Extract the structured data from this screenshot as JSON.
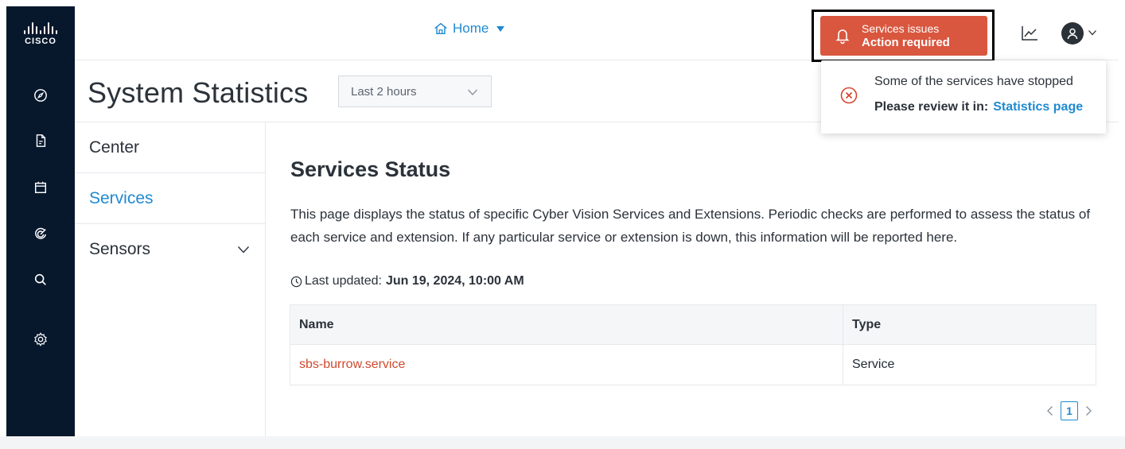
{
  "brand": {
    "logo_text": "CISCO"
  },
  "header": {
    "home_label": "Home",
    "alert": {
      "line1": "Services issues",
      "line2": "Action required"
    }
  },
  "page": {
    "title": "System Statistics",
    "time_range": {
      "selected": "Last 2 hours"
    }
  },
  "popover": {
    "message": "Some of the services have stopped",
    "review_label": "Please review it in:",
    "link_label": "Statistics page"
  },
  "sidebar": {
    "items": [
      {
        "label": "Center"
      },
      {
        "label": "Services"
      },
      {
        "label": "Sensors"
      }
    ],
    "active": "Services"
  },
  "main": {
    "section_title": "Services Status",
    "description": "This page displays the status of specific Cyber Vision Services and Extensions. Periodic checks are performed to assess the status of each service and extension. If any particular service or extension is down, this information will be reported here.",
    "last_updated_label": "Last updated:",
    "last_updated_value": "Jun 19, 2024, 10:00 AM",
    "table": {
      "columns": [
        "Name",
        "Type"
      ],
      "rows": [
        {
          "name": "sbs-burrow.service",
          "type": "Service"
        }
      ]
    },
    "pagination": {
      "current_page": "1"
    }
  },
  "icons": {
    "nav": [
      "compass-icon",
      "report-icon",
      "calendar-icon",
      "preset-icon",
      "search-icon",
      "gear-icon"
    ],
    "header": [
      "home-icon",
      "bell-icon",
      "chart-icon",
      "user-icon"
    ]
  },
  "colors": {
    "nav_bg": "#07182d",
    "accent": "#1f8ad1",
    "alert": "#d9573f",
    "service_link": "#cf4a2e"
  }
}
